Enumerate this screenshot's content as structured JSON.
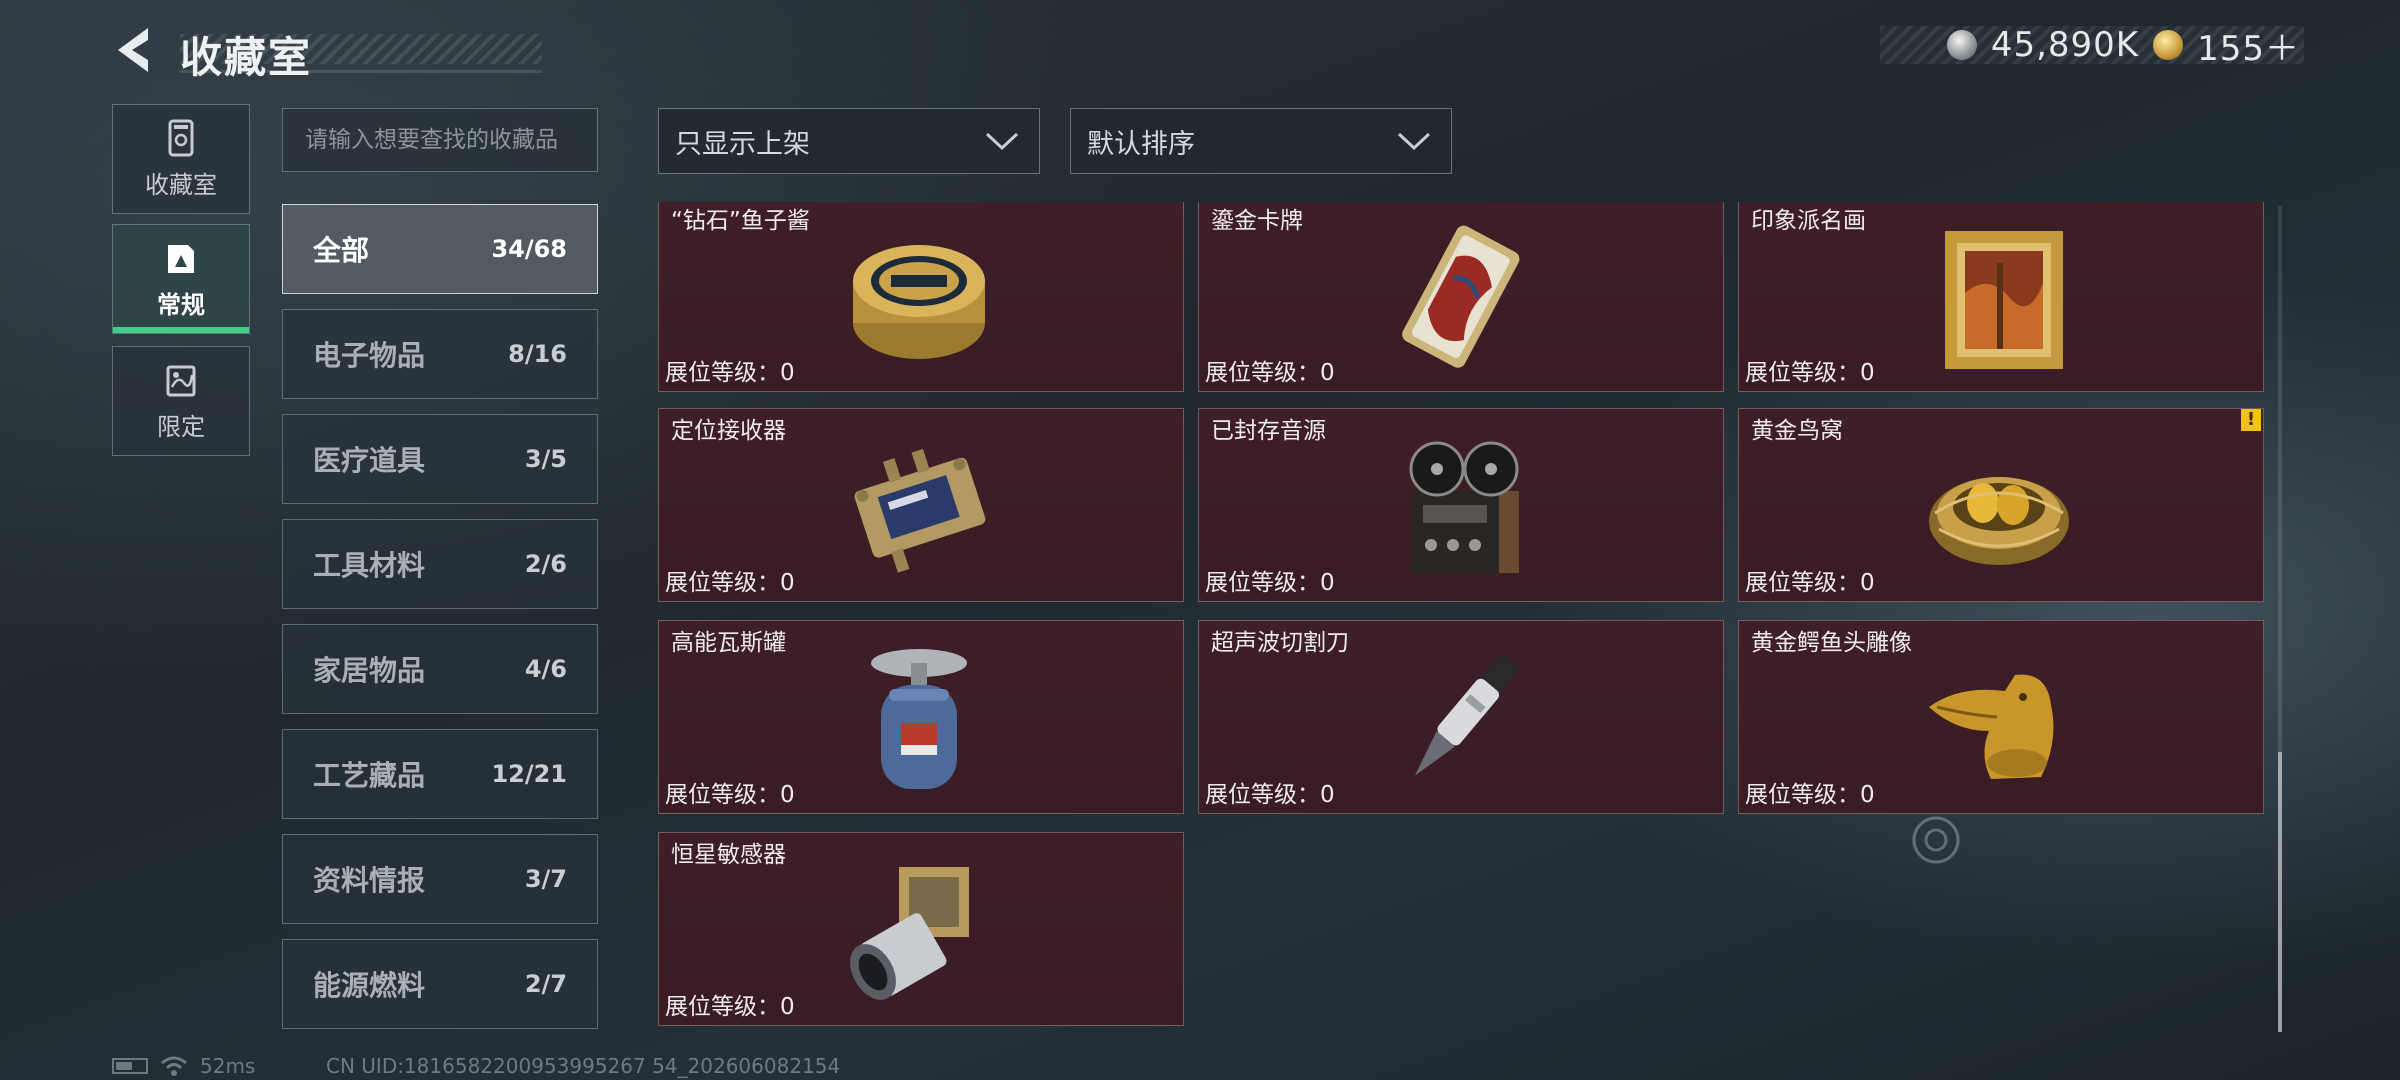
{
  "header": {
    "title": "收藏室",
    "currencies": [
      {
        "icon": "silver-coin-icon",
        "value": "45,890K"
      },
      {
        "icon": "gold-coin-icon",
        "value": "155＋"
      }
    ]
  },
  "nav": [
    {
      "label": "收藏室",
      "icon": "collection-cabinet-icon",
      "active": false
    },
    {
      "label": "常规",
      "icon": "regular-card-icon",
      "active": true
    },
    {
      "label": "限定",
      "icon": "limited-card-icon",
      "active": false
    }
  ],
  "search": {
    "placeholder": "请输入想要查找的收藏品"
  },
  "filters": {
    "display_filter": "只显示上架",
    "sort_order": "默认排序"
  },
  "categories": [
    {
      "name": "全部",
      "count": "34/68",
      "active": true
    },
    {
      "name": "电子物品",
      "count": "8/16"
    },
    {
      "name": "医疗道具",
      "count": "3/5"
    },
    {
      "name": "工具材料",
      "count": "2/6"
    },
    {
      "name": "家居物品",
      "count": "4/6"
    },
    {
      "name": "工艺藏品",
      "count": "12/21"
    },
    {
      "name": "资料情报",
      "count": "3/7"
    },
    {
      "name": "能源燃料",
      "count": "2/7"
    }
  ],
  "items": [
    {
      "name": "“钻石”鱼子酱",
      "level": "展位等级：0",
      "icon": "caviar-tin-icon"
    },
    {
      "name": "鎏金卡牌",
      "level": "展位等级：0",
      "icon": "gilded-card-icon"
    },
    {
      "name": "印象派名画",
      "level": "展位等级：0",
      "icon": "framed-painting-icon"
    },
    {
      "name": "定位接收器",
      "level": "展位等级：0",
      "icon": "locator-receiver-icon"
    },
    {
      "name": "已封存音源",
      "level": "展位等级：0",
      "icon": "reel-to-reel-recorder-icon"
    },
    {
      "name": "黄金鸟窝",
      "level": "展位等级：0",
      "icon": "golden-nest-icon",
      "badge": "!"
    },
    {
      "name": "高能瓦斯罐",
      "level": "展位等级：0",
      "icon": "gas-canister-icon"
    },
    {
      "name": "超声波切割刀",
      "level": "展位等级：0",
      "icon": "ultrasonic-cutter-icon"
    },
    {
      "name": "黄金鳄鱼头雕像",
      "level": "展位等级：0",
      "icon": "golden-crocodile-statue-icon"
    },
    {
      "name": "恒星敏感器",
      "level": "展位等级：0",
      "icon": "star-sensor-icon"
    }
  ],
  "footer": {
    "ping": "52ms",
    "uid": "CN UID:1816582200953995267 54_202606082154"
  }
}
